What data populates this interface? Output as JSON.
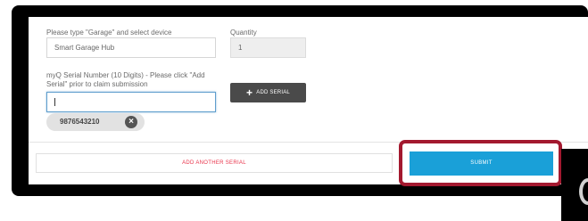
{
  "form": {
    "device_label": "Please type \"Garage\" and select device",
    "device_value": "Smart Garage Hub",
    "quantity_label": "Quantity",
    "quantity_value": "1",
    "serial_label": "myQ Serial Number (10 Digits) - Please click \"Add Serial\" prior to claim submission",
    "serial_value": "",
    "add_serial_label": "ADD SERIAL",
    "serial_chip": "9876543210"
  },
  "actions": {
    "add_another_label": "ADD ANOTHER SERIAL",
    "submit_label": "SUBMIT"
  },
  "colors": {
    "submit": "#1aa0d8",
    "add_another_text": "#e8334a",
    "highlight": "#a3192f",
    "add_serial_button": "#4a4a4a"
  },
  "icons": {
    "add": "plus-icon",
    "remove_chip": "close-icon"
  }
}
